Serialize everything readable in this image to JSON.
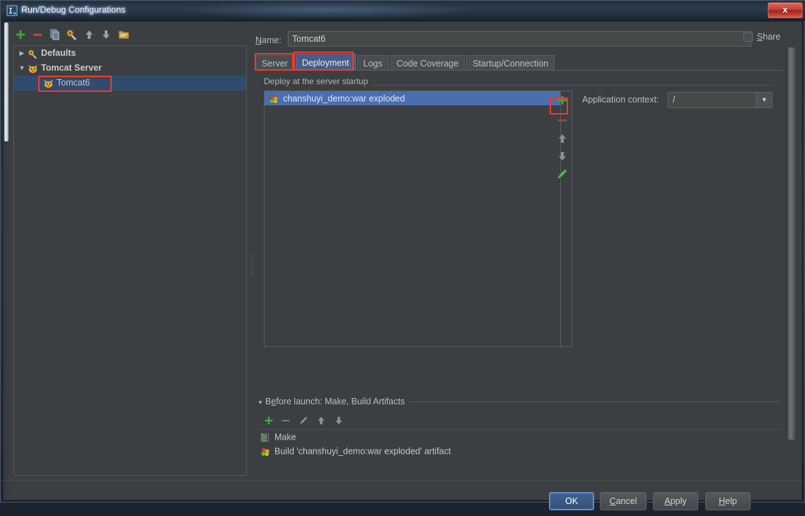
{
  "window": {
    "title": "Run/Debug Configurations",
    "title_icon": "intellij-logo-icon",
    "close_label": "x"
  },
  "left_panel": {
    "toolbar": [
      {
        "name": "add-configuration-button",
        "icon": "plus-icon",
        "label": "+"
      },
      {
        "name": "remove-configuration-button",
        "icon": "minus-icon",
        "label": "−"
      },
      {
        "name": "copy-configuration-button",
        "icon": "copy-icon",
        "label": "copy"
      },
      {
        "name": "edit-defaults-button",
        "icon": "wrench-icon",
        "label": "defaults"
      },
      {
        "name": "move-up-button",
        "icon": "arrow-up-icon",
        "label": "up"
      },
      {
        "name": "move-down-button",
        "icon": "arrow-down-icon",
        "label": "down"
      },
      {
        "name": "create-folder-button",
        "icon": "folder-icon",
        "label": "folder"
      }
    ],
    "tree": [
      {
        "label": "Defaults",
        "icon": "wrench-icon",
        "expander": "▶",
        "indent": 0,
        "selected": false,
        "bold": true
      },
      {
        "label": "Tomcat Server",
        "icon": "tomcat-icon",
        "expander": "▼",
        "indent": 0,
        "selected": false,
        "bold": true
      },
      {
        "label": "Tomcat6",
        "icon": "tomcat-icon",
        "expander": "",
        "indent": 1,
        "selected": true,
        "bold": false
      }
    ]
  },
  "right_panel": {
    "name_label": "Name:",
    "name_label_mnemonic": "N",
    "name_value": "Tomcat6",
    "share": {
      "label": "Share",
      "mnemonic": "S",
      "checked": false
    },
    "tabs": [
      {
        "label": "Server",
        "active": false
      },
      {
        "label": "Deployment",
        "active": true
      },
      {
        "label": "Logs",
        "active": false
      },
      {
        "label": "Code Coverage",
        "active": false
      },
      {
        "label": "Startup/Connection",
        "active": false
      }
    ],
    "deployment": {
      "group_title": "Deploy at the server startup",
      "items": [
        {
          "label": "chanshuyi_demo:war exploded",
          "icon": "artifact-icon",
          "selected": true
        }
      ],
      "list_tools": [
        {
          "name": "add-artifact-button",
          "icon": "plus-icon",
          "label": "+"
        },
        {
          "name": "remove-artifact-button",
          "icon": "minus-icon",
          "label": "−"
        },
        {
          "name": "move-artifact-up-button",
          "icon": "arrow-up-icon",
          "label": "up"
        },
        {
          "name": "move-artifact-down-button",
          "icon": "arrow-down-icon",
          "label": "down"
        },
        {
          "name": "edit-artifact-button",
          "icon": "pencil-icon",
          "label": "edit"
        }
      ],
      "application_context_label": "Application context:",
      "application_context_value": "/"
    }
  },
  "before_launch": {
    "header": "Before launch: Make, Build Artifacts",
    "header_mnemonic": "B",
    "toolbar": [
      {
        "name": "before-launch-add-button",
        "icon": "plus-icon",
        "label": "+"
      },
      {
        "name": "before-launch-remove-button",
        "icon": "minus-icon",
        "label": "−"
      },
      {
        "name": "before-launch-edit-button",
        "icon": "pencil-icon",
        "label": "edit"
      },
      {
        "name": "before-launch-move-up-button",
        "icon": "arrow-up-icon",
        "label": "up"
      },
      {
        "name": "before-launch-move-down-button",
        "icon": "arrow-down-icon",
        "label": "down"
      }
    ],
    "tasks": [
      {
        "label": "Make",
        "icon": "make-icon"
      },
      {
        "label": "Build 'chanshuyi_demo:war exploded' artifact",
        "icon": "artifact-icon"
      }
    ]
  },
  "footer": {
    "buttons": [
      {
        "label": "OK",
        "name": "ok-button",
        "default": true,
        "mnemonic": ""
      },
      {
        "label": "Cancel",
        "name": "cancel-button",
        "default": false,
        "mnemonic": "C"
      },
      {
        "label": "Apply",
        "name": "apply-button",
        "default": false,
        "mnemonic": "A"
      },
      {
        "label": "Help",
        "name": "help-button",
        "default": false,
        "mnemonic": "H"
      }
    ]
  },
  "annotations": {
    "highlight_color": "#f2392c",
    "boxes": [
      {
        "name": "highlight-tree-item-tomcat6"
      },
      {
        "name": "highlight-tab-server"
      },
      {
        "name": "highlight-tab-deployment"
      },
      {
        "name": "highlight-add-artifact-button"
      }
    ]
  },
  "colors": {
    "selection_blue": "#4b6eaf",
    "tab_active_blue": "#4b5d82",
    "tree_selection": "#2f4b6e",
    "panel_bg": "#3c3f41",
    "accent_green": "#4fae4f",
    "accent_red": "#c05a4f"
  }
}
